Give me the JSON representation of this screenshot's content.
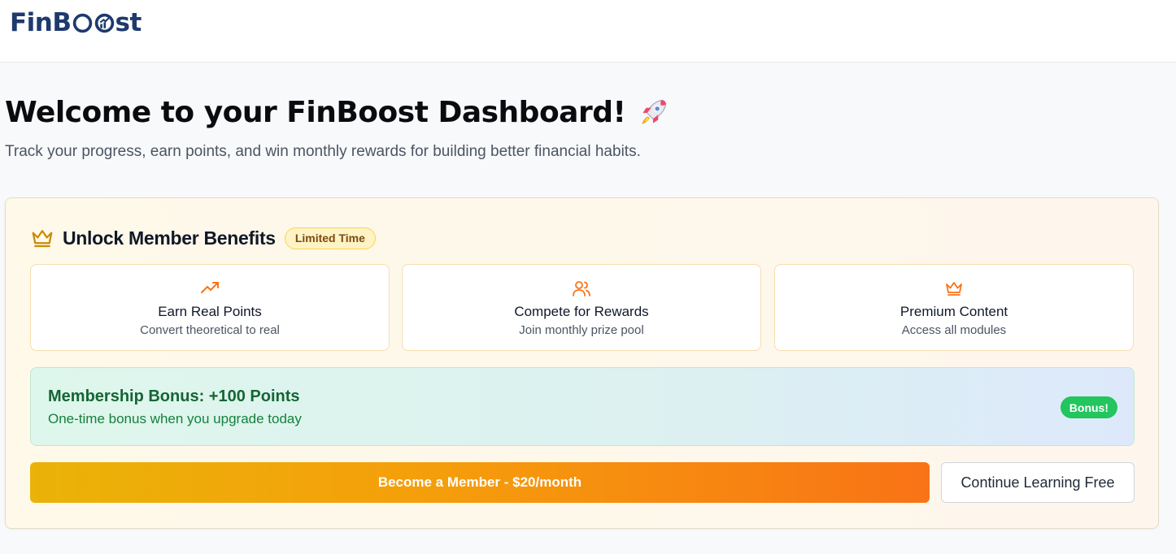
{
  "brand": {
    "name_prefix": "FinB",
    "name_suffix": "st"
  },
  "header": {
    "title": "Welcome to your FinBoost Dashboard!",
    "title_emoji": "rocket-icon",
    "subtitle": "Track your progress, earn points, and win monthly rewards for building better financial habits."
  },
  "membership_card": {
    "title": "Unlock Member Benefits",
    "badge": "Limited Time",
    "benefits": [
      {
        "icon": "trending-up-icon",
        "title": "Earn Real Points",
        "subtitle": "Convert theoretical to real"
      },
      {
        "icon": "users-icon",
        "title": "Compete for Rewards",
        "subtitle": "Join monthly prize pool"
      },
      {
        "icon": "crown-icon",
        "title": "Premium Content",
        "subtitle": "Access all modules"
      }
    ],
    "bonus": {
      "title": "Membership Bonus: +100 Points",
      "subtitle": "One-time bonus when you upgrade today",
      "pill": "Bonus!"
    },
    "primary_button": "Become a Member - $20/month",
    "secondary_button": "Continue Learning Free"
  },
  "colors": {
    "brand_navy": "#1e3a6e",
    "accent_orange": "#f97316",
    "accent_gold": "#eab308",
    "bonus_green": "#22c55e"
  }
}
